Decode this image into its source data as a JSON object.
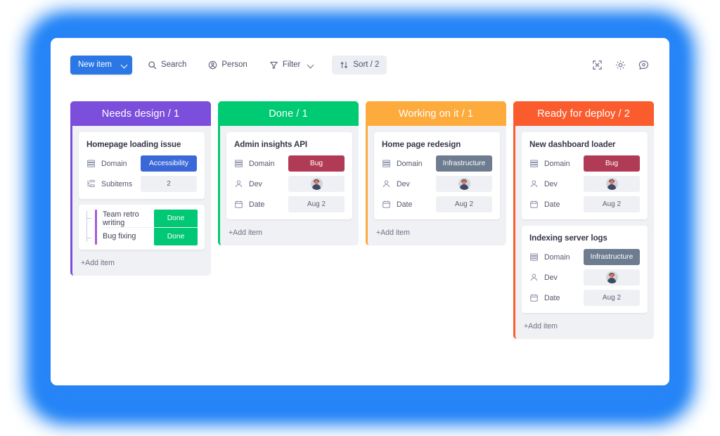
{
  "toolbar": {
    "new_item": {
      "label": "New item",
      "caret_icon": "chevron-down-icon",
      "color": "#2b77e5"
    },
    "search": {
      "label": "Search",
      "icon": "search-icon"
    },
    "person": {
      "label": "Person",
      "icon": "person-circle-icon"
    },
    "filter": {
      "label": "Filter",
      "icon": "funnel-icon",
      "caret_icon": "chevron-down-icon"
    },
    "sort": {
      "label": "Sort / 2",
      "icon": "sort-arrows-icon"
    },
    "actions": [
      {
        "name": "expand-icon",
        "title": "Expand"
      },
      {
        "name": "gear-icon",
        "title": "Settings"
      },
      {
        "name": "chat-icon",
        "title": "Updates"
      }
    ]
  },
  "board": {
    "columns": [
      {
        "title": "Needs design / 1",
        "color": "#7b4edb",
        "add_item_label": "+Add item",
        "cards": [
          {
            "title": "Homepage loading issue",
            "fields": [
              {
                "icon": "status-rows-icon",
                "label": "Domain",
                "value": "Accessibility",
                "type": "badge",
                "color": "#3b68d8"
              },
              {
                "icon": "subitems-icon",
                "label": "Subitems",
                "value": "2",
                "type": "plain"
              }
            ],
            "subitems": [
              {
                "name": "Team retro writing",
                "status": "Done",
                "color": "#00c875"
              },
              {
                "name": "Bug fixing",
                "status": "Done",
                "color": "#00c875"
              }
            ]
          }
        ]
      },
      {
        "title": "Done / 1",
        "color": "#00ca72",
        "add_item_label": "+Add item",
        "cards": [
          {
            "title": "Admin insights API",
            "fields": [
              {
                "icon": "status-rows-icon",
                "label": "Domain",
                "value": "Bug",
                "type": "badge",
                "color": "#b13b54"
              },
              {
                "icon": "person-icon",
                "label": "Dev",
                "value": "",
                "type": "avatar"
              },
              {
                "icon": "calendar-icon",
                "label": "Date",
                "value": "Aug 2",
                "type": "plain"
              }
            ],
            "subitems": []
          }
        ]
      },
      {
        "title": "Working on it / 1",
        "color": "#fdab3d",
        "add_item_label": "+Add item",
        "cards": [
          {
            "title": "Home page redesign",
            "fields": [
              {
                "icon": "status-rows-icon",
                "label": "Domain",
                "value": "Infrastructure",
                "type": "badge",
                "color": "#6d7d8f"
              },
              {
                "icon": "person-icon",
                "label": "Dev",
                "value": "",
                "type": "avatar"
              },
              {
                "icon": "calendar-icon",
                "label": "Date",
                "value": "Aug 2",
                "type": "plain"
              }
            ],
            "subitems": []
          }
        ]
      },
      {
        "title": "Ready for deploy / 2",
        "color": "#fb5c2e",
        "add_item_label": "+Add item",
        "cards": [
          {
            "title": "New dashboard loader",
            "fields": [
              {
                "icon": "status-rows-icon",
                "label": "Domain",
                "value": "Bug",
                "type": "badge",
                "color": "#b13b54"
              },
              {
                "icon": "person-icon",
                "label": "Dev",
                "value": "",
                "type": "avatar"
              },
              {
                "icon": "calendar-icon",
                "label": "Date",
                "value": "Aug 2",
                "type": "plain"
              }
            ],
            "subitems": []
          },
          {
            "title": "Indexing server logs",
            "fields": [
              {
                "icon": "status-rows-icon",
                "label": "Domain",
                "value": "Infrastructure",
                "type": "badge",
                "color": "#6d7d8f"
              },
              {
                "icon": "person-icon",
                "label": "Dev",
                "value": "",
                "type": "avatar"
              },
              {
                "icon": "calendar-icon",
                "label": "Date",
                "value": "Aug 2",
                "type": "plain"
              }
            ],
            "subitems": []
          }
        ]
      }
    ]
  }
}
